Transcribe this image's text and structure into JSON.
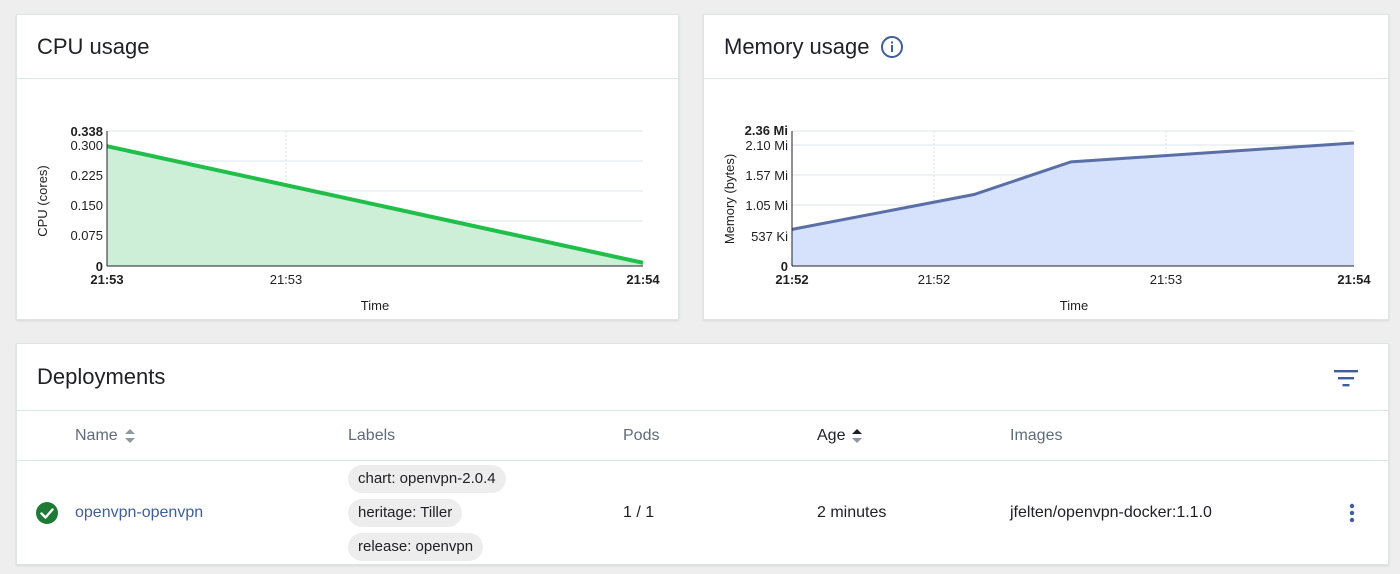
{
  "cpu_card": {
    "title": "CPU usage",
    "chart_data": {
      "type": "area",
      "x": [
        "21:53",
        "21:53",
        "21:54"
      ],
      "y_points": [
        0.3,
        0.008
      ],
      "ylabel": "CPU (cores)",
      "xlabel": "Time",
      "y_ticks": [
        "0.338",
        "0.300",
        "0.225",
        "0.150",
        "0.075",
        "0"
      ],
      "x_ticks": [
        "21:53",
        "21:53",
        "21:54"
      ],
      "ylim": [
        0,
        0.338
      ],
      "color": "#1fbf4a",
      "fill": "#cdeed7"
    }
  },
  "mem_card": {
    "title": "Memory usage",
    "icons": {
      "info": "info-icon"
    },
    "chart_data": {
      "type": "area",
      "series_values_mi": [
        0.64,
        1.25,
        1.82,
        2.15
      ],
      "ylabel": "Memory (bytes)",
      "xlabel": "Time",
      "y_ticks": [
        "2.36 Mi",
        "2.10 Mi",
        "1.57 Mi",
        "1.05 Mi",
        "537 Ki",
        "0"
      ],
      "x_ticks": [
        "21:52",
        "21:52",
        "21:53",
        "21:54"
      ],
      "color": "#5a6fa6",
      "fill": "#d6e1fb"
    }
  },
  "deployments": {
    "title": "Deployments",
    "icons": {
      "filter": "filter-icon",
      "more": "more-vert-icon",
      "status": "check-circle-icon"
    },
    "columns": {
      "name": "Name",
      "labels": "Labels",
      "pods": "Pods",
      "age": "Age",
      "images": "Images"
    },
    "rows": [
      {
        "name": "openvpn-openvpn",
        "labels": [
          "chart: openvpn-2.0.4",
          "heritage: Tiller",
          "release: openvpn"
        ],
        "pods": "1 / 1",
        "age": "2 minutes",
        "images": "jfelten/openvpn-docker:1.1.0"
      }
    ]
  }
}
